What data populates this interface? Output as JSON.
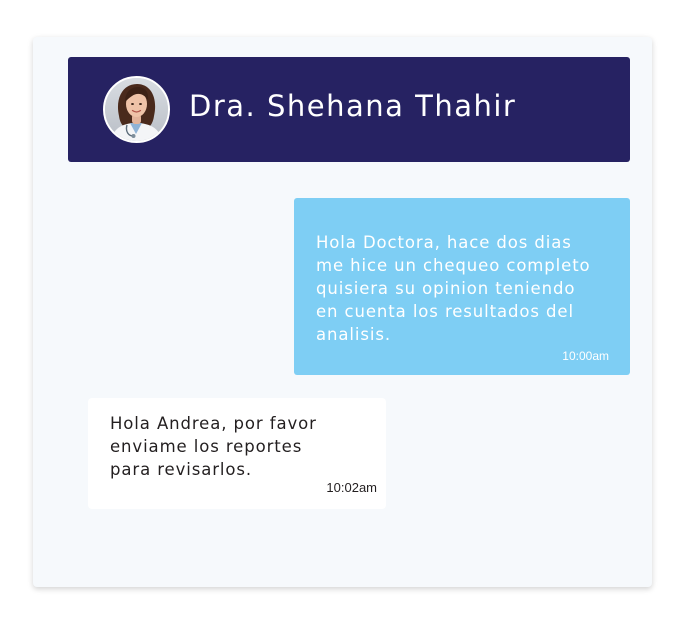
{
  "header": {
    "doctor_name": "Dra. Shehana Thahir"
  },
  "messages": [
    {
      "direction": "outgoing",
      "text": "Hola Doctora, hace dos dias\nme hice un chequeo completo\nquisiera su opinion teniendo\nen cuenta los resultados del\nanalisis.",
      "time": "10:00am"
    },
    {
      "direction": "incoming",
      "text": "Hola Andrea, por favor\nenviame los reportes\npara revisarlos.",
      "time": "10:02am"
    }
  ],
  "colors": {
    "header_bg": "#262262",
    "outgoing_bg": "#7ecef4",
    "incoming_bg": "#ffffff",
    "canvas_bg": "#f6f9fc"
  },
  "icons": {
    "avatar": "doctor-avatar"
  }
}
